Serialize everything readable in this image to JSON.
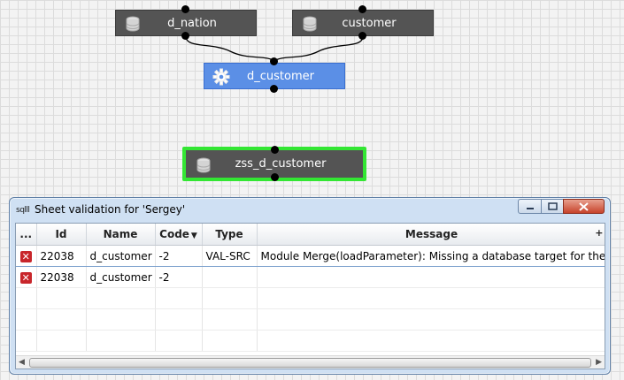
{
  "canvas": {
    "nodes": [
      {
        "id": "n1",
        "label": "d_nation",
        "icon": "database-icon"
      },
      {
        "id": "n2",
        "label": "customer",
        "icon": "database-icon"
      },
      {
        "id": "n3",
        "label": "d_customer",
        "icon": "gear-icon"
      },
      {
        "id": "n4",
        "label": "zss_d_customer",
        "icon": "database-icon"
      }
    ]
  },
  "dialog": {
    "app_icon": "sqlll",
    "title": "Sheet validation for 'Sergey'",
    "columns": {
      "more": "...",
      "id": "Id",
      "name": "Name",
      "code": "Code",
      "type": "Type",
      "message": "Message",
      "add": "+"
    },
    "rows": [
      {
        "id": "22038",
        "name": "d_customer",
        "code": "-2",
        "type": "VAL-SRC",
        "message": "Module Merge(loadParameter): Missing a database target for the action"
      },
      {
        "id": "22038",
        "name": "d_customer",
        "code": "-2",
        "type": "",
        "message": ""
      }
    ]
  },
  "colors": {
    "error": "#c8262b",
    "selection_border": "#33e633",
    "transform_node": "#5b8fe6",
    "db_node": "#545454"
  }
}
